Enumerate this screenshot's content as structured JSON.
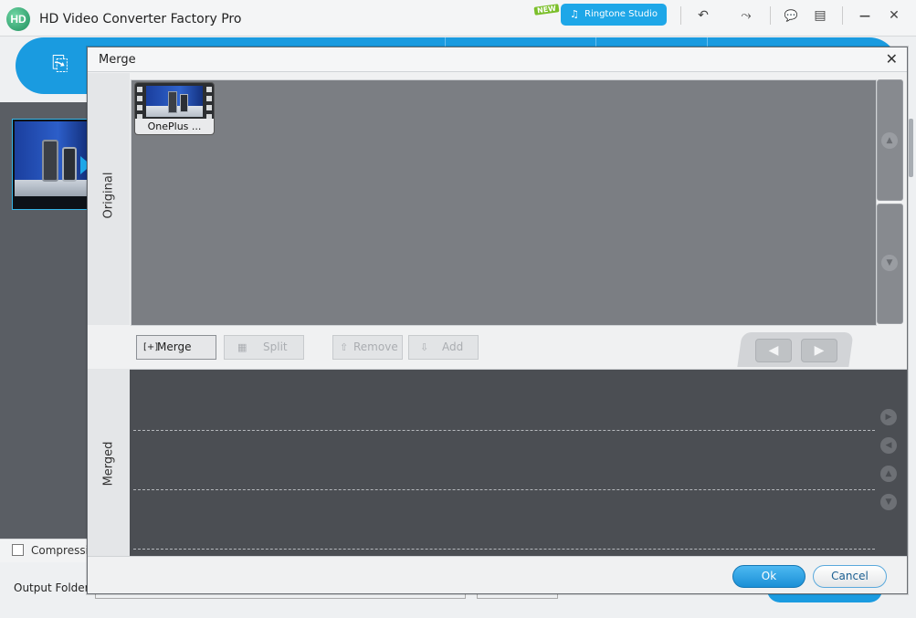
{
  "app": {
    "logo_text": "HD",
    "title": "HD Video Converter Factory Pro",
    "new_badge": "NEW",
    "ringtone_studio": "Ringtone Studio",
    "compression_label": "Compression",
    "output_folder_label": "Output Folder:"
  },
  "icons": {
    "undo": "↶",
    "tools": "⤳",
    "chat": "💬",
    "list": "▤",
    "minimize": "—",
    "close": "✕",
    "ringtone": "♫",
    "add_file": "⎘"
  },
  "dialog": {
    "title": "Merge",
    "close_glyph": "✕",
    "original_label": "Original",
    "merged_label": "Merged",
    "clip": {
      "name": "OnePlus ..."
    },
    "buttons": {
      "merge": "Merge",
      "split": "Split",
      "remove": "Remove",
      "add": "Add",
      "ok": "Ok",
      "cancel": "Cancel"
    },
    "button_glyphs": {
      "merge": "[+]",
      "split": "▦",
      "remove": "⇧",
      "add": "⇩",
      "prev": "◀",
      "next": "▶",
      "up": "▲",
      "down": "▼",
      "play": "▶",
      "back": "◀"
    }
  },
  "colors": {
    "accent": "#1a9be0",
    "original_panel": "#7b7e83",
    "merged_panel": "#4b4e53"
  }
}
